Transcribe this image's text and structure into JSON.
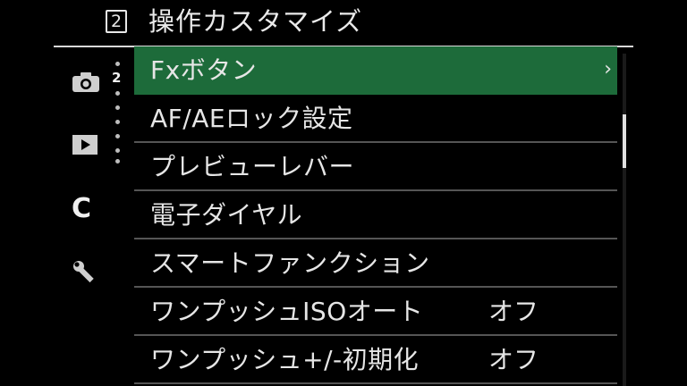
{
  "header": {
    "page_number": "2",
    "title": "操作カスタマイズ"
  },
  "sidebar": {
    "sub_page_number": "2",
    "tabs": [
      {
        "icon": "camera-icon"
      },
      {
        "icon": "play-icon"
      },
      {
        "icon": "custom-icon",
        "label": "C"
      },
      {
        "icon": "wrench-icon"
      }
    ]
  },
  "menu": {
    "items": [
      {
        "label": "Fxボタン",
        "value": "",
        "selected": true
      },
      {
        "label": "AF/AEロック設定",
        "value": ""
      },
      {
        "label": "プレビューレバー",
        "value": ""
      },
      {
        "label": "電子ダイヤル",
        "value": ""
      },
      {
        "label": "スマートファンクション",
        "value": ""
      },
      {
        "label": "ワンプッシュISOオート",
        "value": "オフ"
      },
      {
        "label": "ワンプッシュ+/-初期化",
        "value": "オフ"
      }
    ]
  },
  "colors": {
    "selected_bg": "#1d6b3a",
    "background": "#000000"
  }
}
